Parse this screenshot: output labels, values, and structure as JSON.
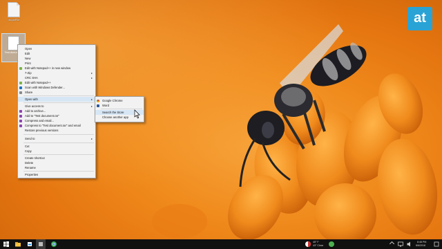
{
  "desktop": {
    "icons": [
      {
        "label": "dropbFile",
        "icon": "file-icon"
      },
      {
        "label": "Test document",
        "icon": "text-file-icon"
      }
    ]
  },
  "brand": {
    "text": "at",
    "color": "#29a3d6"
  },
  "context_menu": {
    "items": [
      {
        "label": "Open"
      },
      {
        "label": "Edit"
      },
      {
        "label": "New"
      },
      {
        "label": "Print"
      },
      {
        "label": "Edit with Notepad++ in new window"
      },
      {
        "label": "7-Zip",
        "submenu": true
      },
      {
        "label": "CRC SHA",
        "submenu": true
      },
      {
        "label": "Edit with Notepad++"
      },
      {
        "label": "Scan with Windows Defender..."
      },
      {
        "label": "Share"
      },
      {
        "label": "Open with",
        "submenu": true,
        "highlighted": true
      },
      {
        "label": "Give access to",
        "submenu": true
      },
      {
        "label": "Add to archive..."
      },
      {
        "label": "Add to \"Test document.rar\""
      },
      {
        "label": "Compress and email..."
      },
      {
        "label": "Compress to \"Test document.rar\" and email"
      },
      {
        "label": "Restore previous versions"
      },
      {
        "label": "Send to",
        "submenu": true
      },
      {
        "label": "Cut"
      },
      {
        "label": "Copy"
      },
      {
        "label": "Create shortcut"
      },
      {
        "label": "Delete"
      },
      {
        "label": "Rename"
      },
      {
        "label": "Properties"
      }
    ]
  },
  "open_with_submenu": {
    "items": [
      {
        "label": "Google Chrome",
        "icon": "chrome-icon"
      },
      {
        "label": "Word",
        "icon": "word-icon"
      },
      {
        "label": "Search the Store",
        "highlighted": true
      },
      {
        "label": "Choose another app"
      }
    ]
  },
  "taskbar": {
    "tray_text_1": "45° F",
    "tray_text_2": "43° Clear",
    "clock_time": "8:48 PM",
    "clock_date": "8/6/2018"
  }
}
